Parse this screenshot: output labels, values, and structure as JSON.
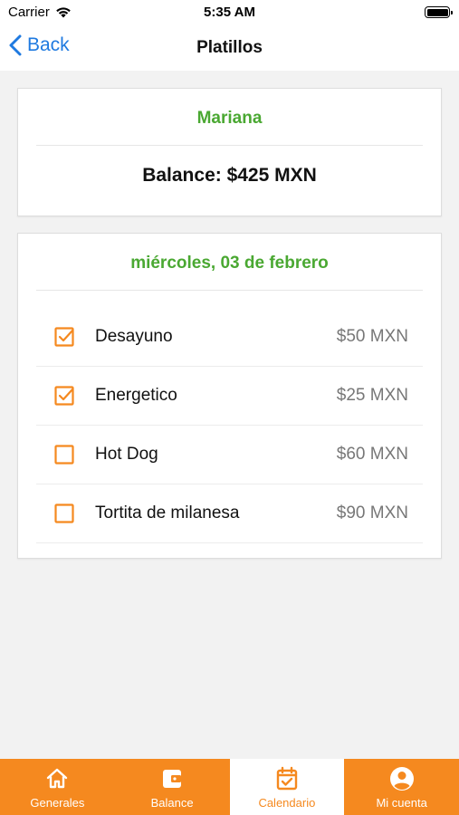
{
  "status_bar": {
    "carrier": "Carrier",
    "time": "5:35 AM"
  },
  "nav": {
    "back_label": "Back",
    "title": "Platillos"
  },
  "user_card": {
    "name": "Mariana",
    "balance": "Balance: $425 MXN"
  },
  "menu_card": {
    "date": "miércoles, 03 de febrero",
    "items": [
      {
        "name": "Desayuno",
        "price": "$50 MXN",
        "checked": true
      },
      {
        "name": "Energetico",
        "price": "$25 MXN",
        "checked": true
      },
      {
        "name": "Hot Dog",
        "price": "$60 MXN",
        "checked": false
      },
      {
        "name": "Tortita de milanesa",
        "price": "$90 MXN",
        "checked": false
      }
    ]
  },
  "tab_bar": {
    "tabs": [
      {
        "label": "Generales",
        "icon": "home-icon",
        "active": false
      },
      {
        "label": "Balance",
        "icon": "wallet-icon",
        "active": false
      },
      {
        "label": "Calendario",
        "icon": "calendar-check-icon",
        "active": true
      },
      {
        "label": "Mi cuenta",
        "icon": "account-circle-icon",
        "active": false
      }
    ]
  },
  "colors": {
    "accent": "#f5891f",
    "green": "#4aa832",
    "link": "#1f7ae0"
  }
}
